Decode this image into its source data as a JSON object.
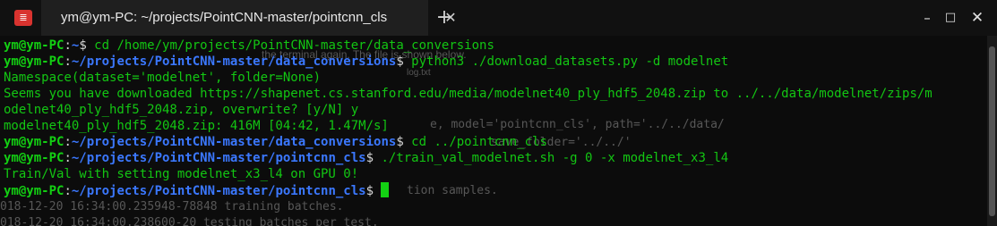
{
  "titlebar": {
    "app_icon_glyph": "≣",
    "tab_title": "ym@ym-PC: ~/projects/PointCNN-master/pointcnn_cls",
    "close_tab_icon": "close-icon",
    "new_tab_icon": "plus-icon",
    "minimize_glyph": "–",
    "maximize_glyph": "□",
    "close_glyph": "✕"
  },
  "ghost_text": {
    "t1": "the terminal again. The file is shown below.",
    "t2": "log.txt",
    "t3": "e, model='pointcnn_cls', path='../../data/",
    "t4": "save_folder='../../'",
    "t5": "tion samples.",
    "t6": "018-12-20 16:34:00.235948-78848 training batches.",
    "t7": "018-12-20 16:34:00.238600-20 testing batches per test."
  },
  "terminal": {
    "lines": [
      {
        "kind": "prompt",
        "user": "ym@ym-PC",
        "path": "~",
        "cmd": "cd /home/ym/projects/PointCNN-master/data_conversions"
      },
      {
        "kind": "prompt",
        "user": "ym@ym-PC",
        "path": "~/projects/PointCNN-master/data_conversions",
        "cmd": "python3 ./download_datasets.py -d modelnet"
      },
      {
        "kind": "output",
        "text": "Namespace(dataset='modelnet', folder=None)"
      },
      {
        "kind": "output",
        "text": "Seems you have downloaded https://shapenet.cs.stanford.edu/media/modelnet40_ply_hdf5_2048.zip to ../../data/modelnet/zips/m"
      },
      {
        "kind": "output",
        "text": "odelnet40_ply_hdf5_2048.zip, overwrite? [y/N] y"
      },
      {
        "kind": "output",
        "text": "modelnet40_ply_hdf5_2048.zip: 416M [04:42, 1.47M/s]"
      },
      {
        "kind": "prompt",
        "user": "ym@ym-PC",
        "path": "~/projects/PointCNN-master/data_conversions",
        "cmd": "cd ../pointcnn_cls"
      },
      {
        "kind": "prompt",
        "user": "ym@ym-PC",
        "path": "~/projects/PointCNN-master/pointcnn_cls",
        "cmd": "./train_val_modelnet.sh -g 0 -x modelnet_x3_l4"
      },
      {
        "kind": "output",
        "text": "Train/Val with setting modelnet_x3_l4 on GPU 0!"
      },
      {
        "kind": "prompt",
        "user": "ym@ym-PC",
        "path": "~/projects/PointCNN-master/pointcnn_cls",
        "cmd": ""
      }
    ]
  },
  "colors": {
    "user": "#13d013",
    "path": "#3b78ff",
    "output": "#13c613",
    "app_icon": "#d9332f"
  }
}
